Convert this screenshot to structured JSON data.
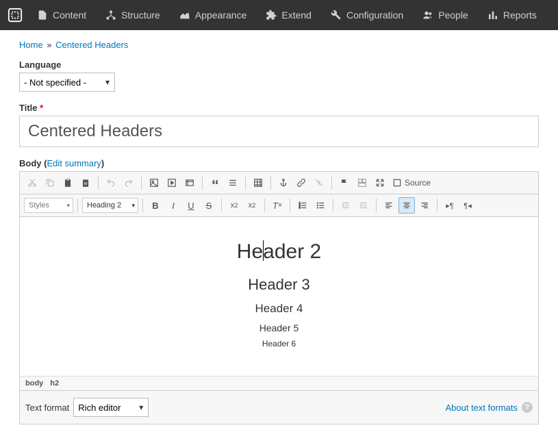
{
  "admin_nav": {
    "items": [
      {
        "label": "Content"
      },
      {
        "label": "Structure"
      },
      {
        "label": "Appearance"
      },
      {
        "label": "Extend"
      },
      {
        "label": "Configuration"
      },
      {
        "label": "People"
      },
      {
        "label": "Reports"
      }
    ]
  },
  "breadcrumb": {
    "home": "Home",
    "sep": "»",
    "current": "Centered Headers"
  },
  "language": {
    "label": "Language",
    "value": "- Not specified -"
  },
  "title": {
    "label": "Title",
    "value": "Centered Headers"
  },
  "body": {
    "label": "Body",
    "edit_summary": "Edit summary",
    "content": {
      "h2": "Header 2",
      "h3": "Header 3",
      "h4": "Header 4",
      "h5": "Header 5",
      "h6": "Header 6"
    },
    "path": [
      "body",
      "h2"
    ]
  },
  "toolbar": {
    "styles_label": "Styles",
    "format_label": "Heading 2",
    "source_label": "Source"
  },
  "text_format": {
    "label": "Text format",
    "value": "Rich editor",
    "about": "About text formats"
  }
}
